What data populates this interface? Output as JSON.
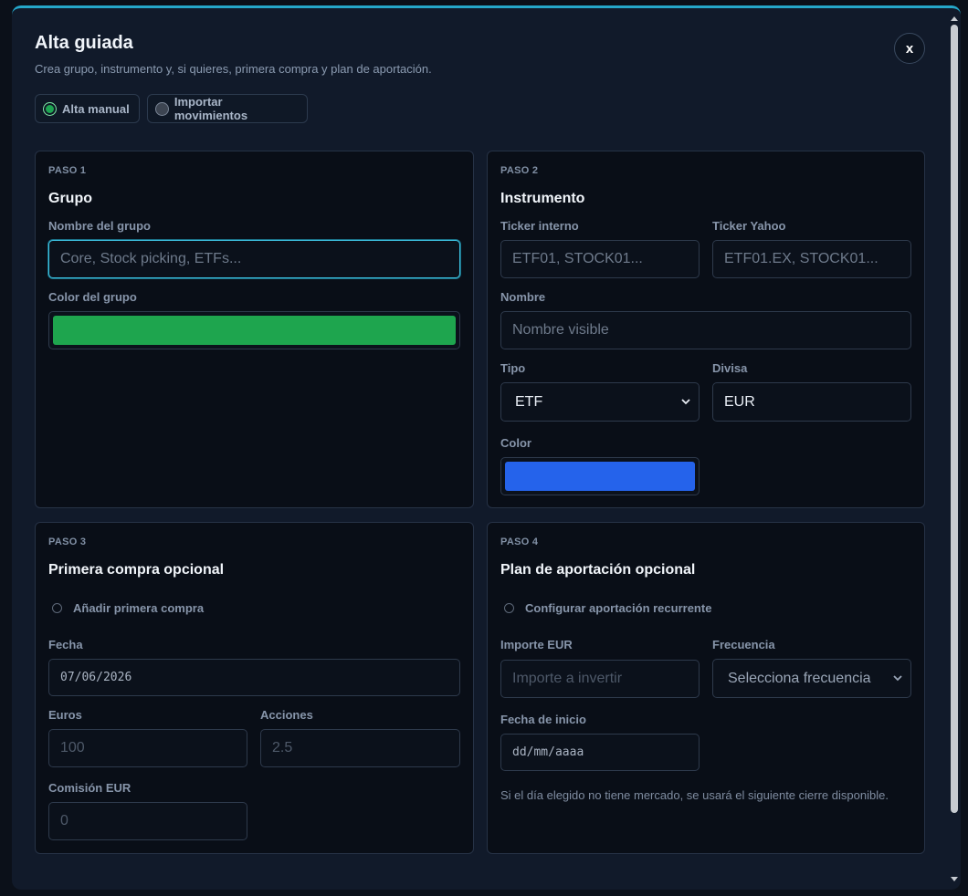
{
  "modal": {
    "title": "Alta guiada",
    "subtitle": "Crea grupo, instrumento y, si quieres, primera compra y plan de aportación.",
    "close_label": "x"
  },
  "mode": {
    "manual_label": "Alta manual",
    "import_label": "Importar movimientos",
    "selected": "Alta manual"
  },
  "step1": {
    "step_label": "PASO 1",
    "title": "Grupo",
    "group_name_label": "Nombre del grupo",
    "group_name_placeholder": "Core, Stock picking, ETFs...",
    "group_color_label": "Color del grupo",
    "group_color": "#1ea54e"
  },
  "step2": {
    "step_label": "PASO 2",
    "title": "Instrumento",
    "ticker_internal_label": "Ticker interno",
    "ticker_internal_placeholder": "ETF01, STOCK01...",
    "ticker_yahoo_label": "Ticker Yahoo",
    "ticker_yahoo_placeholder": "ETF01.EX, STOCK01...",
    "name_label": "Nombre",
    "name_placeholder": "Nombre visible",
    "type_label": "Tipo",
    "type_value": "ETF",
    "currency_label": "Divisa",
    "currency_value": "EUR",
    "color_label": "Color",
    "color": "#2563eb"
  },
  "step3": {
    "step_label": "PASO 3",
    "title": "Primera compra opcional",
    "add_purchase_label": "Añadir primera compra",
    "date_label": "Fecha",
    "date_value": "07/06/2026",
    "euros_label": "Euros",
    "euros_placeholder": "100",
    "shares_label": "Acciones",
    "shares_placeholder": "2.5",
    "fee_label": "Comisión EUR",
    "fee_placeholder": "0"
  },
  "step4": {
    "step_label": "PASO 4",
    "title": "Plan de aportación opcional",
    "recurring_label": "Configurar aportación recurrente",
    "amount_label": "Importe EUR",
    "amount_placeholder": "Importe a invertir",
    "frequency_label": "Frecuencia",
    "frequency_value": "Selecciona frecuencia",
    "start_date_label": "Fecha de inicio",
    "start_date_placeholder": "dd/mm/aaaa",
    "note": "Si el día elegido no tiene mercado, se usará el siguiente cierre disponible."
  },
  "colors": {
    "accent": "#25a7c9",
    "background": "#111a2a",
    "card": "#090e17"
  }
}
